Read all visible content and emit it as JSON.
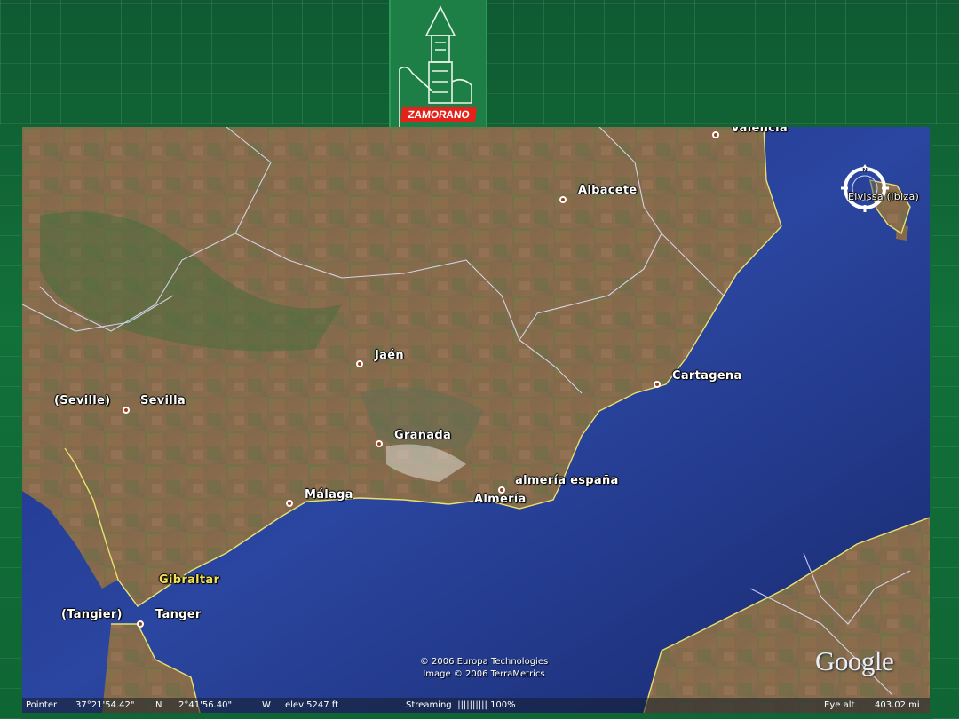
{
  "logo": {
    "text": "ZAMORANO"
  },
  "map": {
    "places": [
      {
        "id": "valencia",
        "label": "Valencia"
      },
      {
        "id": "albacete",
        "label": "Albacete"
      },
      {
        "id": "ibiza",
        "label": "Eivissa (Ibiza)"
      },
      {
        "id": "jaen",
        "label": "Jaén"
      },
      {
        "id": "cartagena",
        "label": "Cartagena"
      },
      {
        "id": "seville_en",
        "label": "(Seville)"
      },
      {
        "id": "sevilla",
        "label": "Sevilla"
      },
      {
        "id": "granada",
        "label": "Granada"
      },
      {
        "id": "almeria_espana",
        "label": "almería españa"
      },
      {
        "id": "malaga",
        "label": "Málaga"
      },
      {
        "id": "almeria",
        "label": "Almería"
      },
      {
        "id": "gibraltar",
        "label": "Gibraltar"
      },
      {
        "id": "tangier_en",
        "label": "(Tangier)"
      },
      {
        "id": "tanger",
        "label": "Tanger"
      }
    ],
    "copyright_line1": "© 2006 Europa Technologies",
    "copyright_line2": "Image © 2006 TerraMetrics",
    "brand": "Google",
    "compass_label": "N"
  },
  "status_bar": {
    "pointer_label": "Pointer",
    "lat": "37°21'54.42\"",
    "lat_dir": "N",
    "lon": "2°41'56.40\"",
    "lon_dir": "W",
    "elev": "elev  5247 ft",
    "streaming": "Streaming ||||||||||| 100%",
    "eye_alt_label": "Eye alt",
    "eye_alt": "403.02 mi"
  },
  "colors": {
    "slide_green": "#127039",
    "sea": "#1f3a8f",
    "land": "#7a6a48",
    "coast": "#e8e070",
    "border": "#dfe5ff",
    "logo_red": "#e3231b"
  }
}
